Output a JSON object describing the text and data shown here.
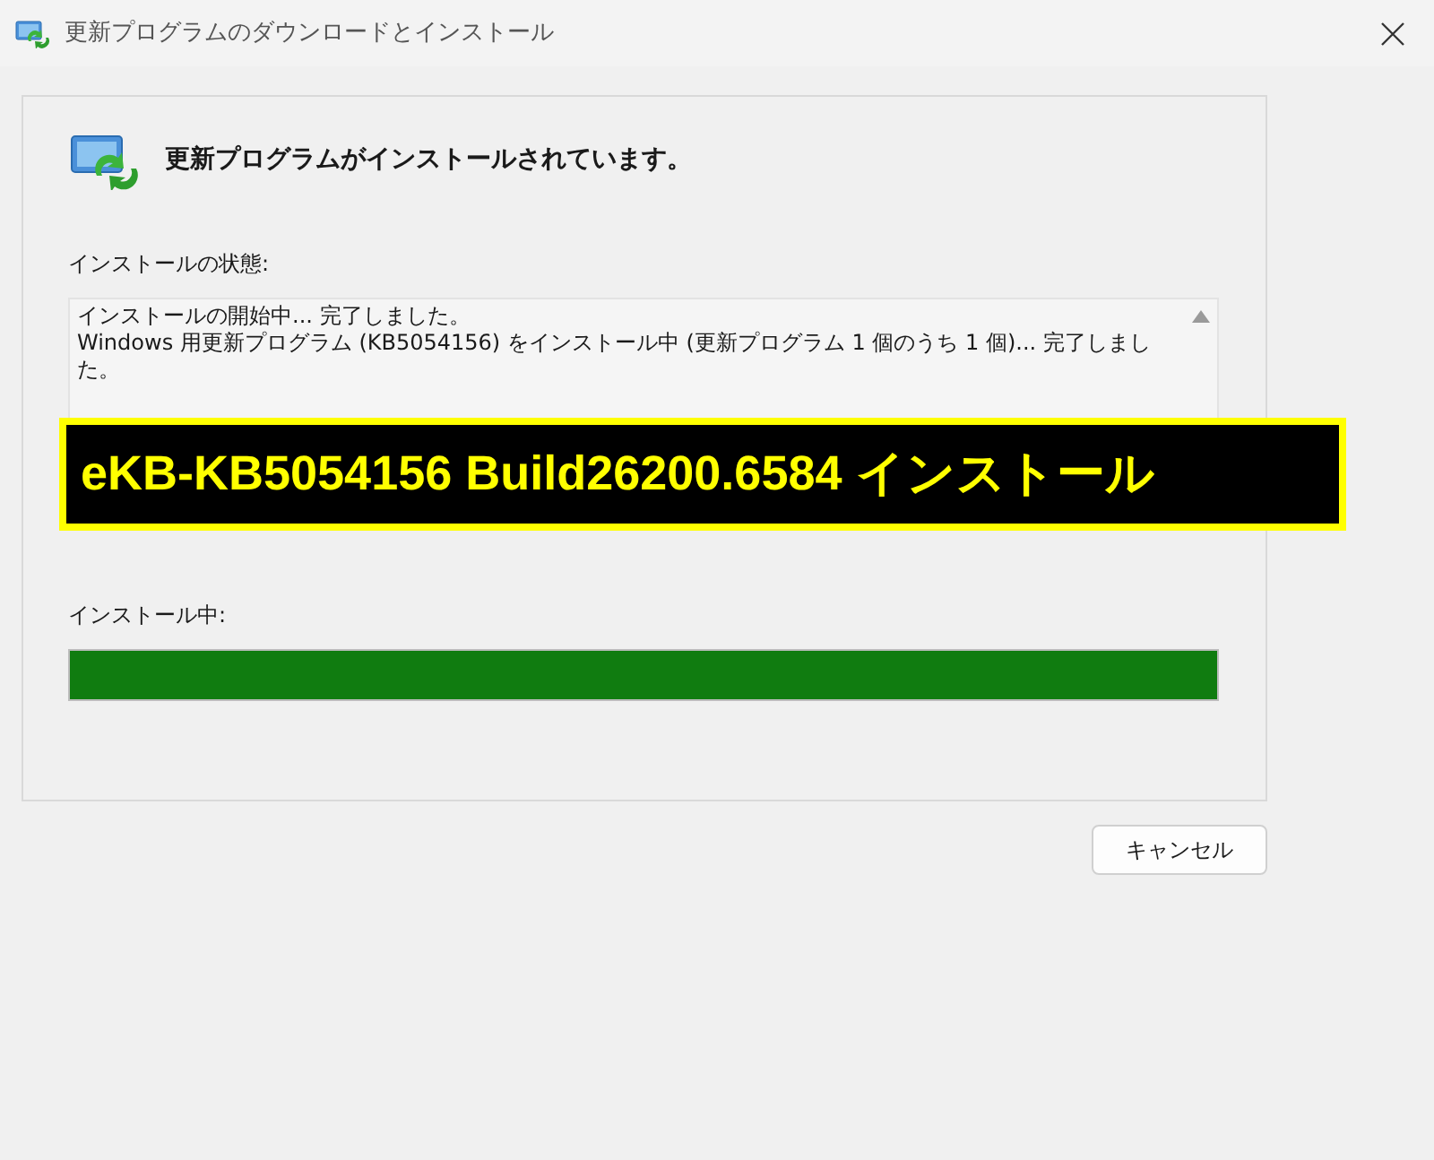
{
  "window": {
    "title": "更新プログラムのダウンロードとインストール"
  },
  "heading": "更新プログラムがインストールされています。",
  "status": {
    "label": "インストールの状態:",
    "log": [
      "インストールの開始中... 完了しました。",
      "Windows 用更新プログラム (KB5054156) をインストール中 (更新プログラム 1 個のうち 1 個)... 完了しました。"
    ]
  },
  "overlay_caption": "eKB-KB5054156 Build26200.6584 インストール",
  "progress": {
    "label": "インストール中:",
    "level": 1
  },
  "buttons": [
    "キャンセル"
  ]
}
